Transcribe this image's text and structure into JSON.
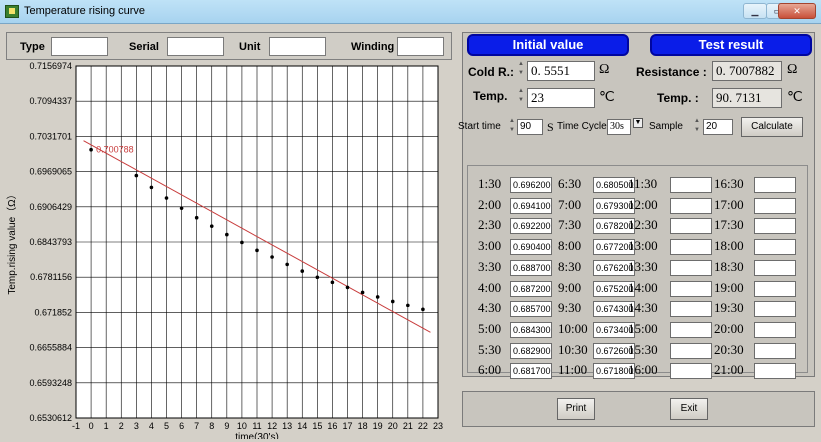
{
  "window": {
    "title": "Temperature rising curve",
    "controls": [
      "minimize",
      "restore",
      "close"
    ]
  },
  "info": {
    "type_label": "Type",
    "type_value": "",
    "serial_label": "Serial",
    "serial_value": "",
    "unit_label": "Unit",
    "unit_value": "",
    "winding_label": "Winding",
    "winding_value": ""
  },
  "chart_data": {
    "type": "scatter",
    "xlabel": "time(30's)",
    "ylabel": "Temp.rising value（Ω）",
    "x_ticks": [
      "-1",
      "0",
      "1",
      "2",
      "3",
      "4",
      "5",
      "6",
      "7",
      "8",
      "9",
      "10",
      "11",
      "12",
      "13",
      "14",
      "15",
      "16",
      "17",
      "18",
      "19",
      "20",
      "21",
      "22",
      "23"
    ],
    "y_ticks": [
      "0.6530612",
      "0.6593248",
      "0.6655884",
      "0.671852",
      "0.6781156",
      "0.6843793",
      "0.6906429",
      "0.6969065",
      "0.7031701",
      "0.7094337",
      "0.7156974"
    ],
    "xlim": [
      -1,
      23
    ],
    "ylim": [
      0.6530612,
      0.7156974
    ],
    "points": [
      {
        "x": 0,
        "y": 0.7008
      },
      {
        "x": 3,
        "y": 0.6962
      },
      {
        "x": 4,
        "y": 0.6941
      },
      {
        "x": 5,
        "y": 0.6922
      },
      {
        "x": 6,
        "y": 0.6904
      },
      {
        "x": 7,
        "y": 0.6887
      },
      {
        "x": 8,
        "y": 0.6872
      },
      {
        "x": 9,
        "y": 0.6857
      },
      {
        "x": 10,
        "y": 0.6843
      },
      {
        "x": 11,
        "y": 0.6829
      },
      {
        "x": 12,
        "y": 0.6817
      },
      {
        "x": 13,
        "y": 0.6804
      },
      {
        "x": 14,
        "y": 0.6792
      },
      {
        "x": 15,
        "y": 0.6781
      },
      {
        "x": 16,
        "y": 0.6772
      },
      {
        "x": 17,
        "y": 0.6763
      },
      {
        "x": 18,
        "y": 0.6754
      },
      {
        "x": 19,
        "y": 0.6746
      },
      {
        "x": 20,
        "y": 0.6738
      },
      {
        "x": 21,
        "y": 0.6731
      },
      {
        "x": 22,
        "y": 0.6724
      }
    ],
    "fit_line": [
      {
        "x": -0.5,
        "y": 0.7024
      },
      {
        "x": 22.5,
        "y": 0.6683
      }
    ],
    "annotation": "0.700788",
    "grid": true,
    "colors": {
      "points": "#000000",
      "fit_line": "#c83c3c",
      "annotation": "#c83c3c",
      "plot_bg": "#ffffff"
    }
  },
  "initial": {
    "header": "Initial value",
    "cold_label": "Cold R.:",
    "cold_value": "0. 5551",
    "cold_unit": "Ω",
    "temp_label": "Temp.",
    "temp_value": "23",
    "temp_unit": "℃"
  },
  "result": {
    "header": "Test result",
    "resistance_label": "Resistance :",
    "resistance_value": "0. 7007882",
    "resistance_unit": "Ω",
    "temp_label": "Temp. :",
    "temp_value": "90. 7131",
    "temp_unit": "℃"
  },
  "settings": {
    "start_time_label": "Start time",
    "start_time_value": "90",
    "start_unit": "S",
    "cycle_label": "Time Cycle",
    "cycle_value": "30s",
    "sample_label": "Sample",
    "sample_value": "20",
    "calculate_label": "Calculate"
  },
  "readings": {
    "col1": [
      {
        "time": "1:30",
        "value": "0.696200"
      },
      {
        "time": "2:00",
        "value": "0.694100"
      },
      {
        "time": "2:30",
        "value": "0.692200"
      },
      {
        "time": "3:00",
        "value": "0.690400"
      },
      {
        "time": "3:30",
        "value": "0.688700"
      },
      {
        "time": "4:00",
        "value": "0.687200"
      },
      {
        "time": "4:30",
        "value": "0.685700"
      },
      {
        "time": "5:00",
        "value": "0.684300"
      },
      {
        "time": "5:30",
        "value": "0.682900"
      },
      {
        "time": "6:00",
        "value": "0.681700"
      }
    ],
    "col2": [
      {
        "time": "6:30",
        "value": "0.680500"
      },
      {
        "time": "7:00",
        "value": "0.679300"
      },
      {
        "time": "7:30",
        "value": "0.678200"
      },
      {
        "time": "8:00",
        "value": "0.677200"
      },
      {
        "time": "8:30",
        "value": "0.676200"
      },
      {
        "time": "9:00",
        "value": "0.675200"
      },
      {
        "time": "9:30",
        "value": "0.674300"
      },
      {
        "time": "10:00",
        "value": "0.673400"
      },
      {
        "time": "10:30",
        "value": "0.672600"
      },
      {
        "time": "11:00",
        "value": "0.671800"
      }
    ],
    "col3": [
      {
        "time": "11:30",
        "value": ""
      },
      {
        "time": "12:00",
        "value": ""
      },
      {
        "time": "12:30",
        "value": ""
      },
      {
        "time": "13:00",
        "value": ""
      },
      {
        "time": "13:30",
        "value": ""
      },
      {
        "time": "14:00",
        "value": ""
      },
      {
        "time": "14:30",
        "value": ""
      },
      {
        "time": "15:00",
        "value": ""
      },
      {
        "time": "15:30",
        "value": ""
      },
      {
        "time": "16:00",
        "value": ""
      }
    ],
    "col4": [
      {
        "time": "16:30",
        "value": ""
      },
      {
        "time": "17:00",
        "value": ""
      },
      {
        "time": "17:30",
        "value": ""
      },
      {
        "time": "18:00",
        "value": ""
      },
      {
        "time": "18:30",
        "value": ""
      },
      {
        "time": "19:00",
        "value": ""
      },
      {
        "time": "19:30",
        "value": ""
      },
      {
        "time": "20:00",
        "value": ""
      },
      {
        "time": "20:30",
        "value": ""
      },
      {
        "time": "21:00",
        "value": ""
      }
    ]
  },
  "actions": {
    "print_label": "Print",
    "exit_label": "Exit"
  }
}
